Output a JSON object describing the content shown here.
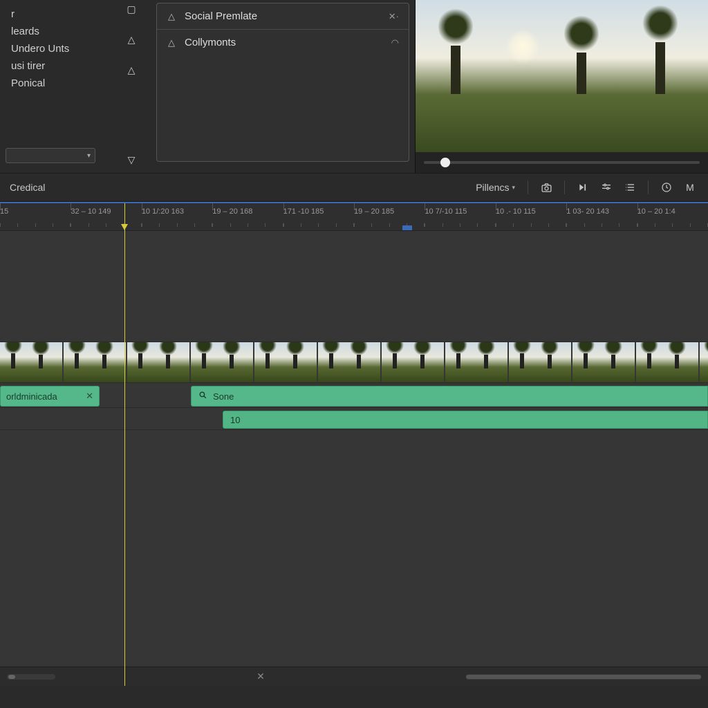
{
  "leftPanel": {
    "items": [
      "r",
      "leards",
      "Undero Unts",
      "usi tirer",
      "Ponical"
    ]
  },
  "midIcons": {
    "square": "square-icon",
    "triUp": "triangle-solid-icon",
    "triOutline": "triangle-outline-icon",
    "triDown": "triangle-down-icon"
  },
  "presets": {
    "row1": {
      "label": "Social Premlate",
      "right": "✕·"
    },
    "row2": {
      "label": "Collymonts",
      "right": "◠"
    }
  },
  "toolbar": {
    "tab": "Credical",
    "dropdown": "Pillencs",
    "rightLabel": "M"
  },
  "ruler": {
    "marks": [
      "15",
      "32 – 10 149",
      "10 1/:20 163",
      "19 – 20 168",
      "171 -10 185",
      "19 – 20 185",
      "10 7/-10 115",
      "10 .- 10 115",
      "1 03- 20 143",
      "10 – 20 1:4"
    ]
  },
  "clips": {
    "a1_left": "orldminicada",
    "a1_right": "Sone",
    "a2": "10"
  },
  "preview": {
    "scrubPosition": 6
  }
}
